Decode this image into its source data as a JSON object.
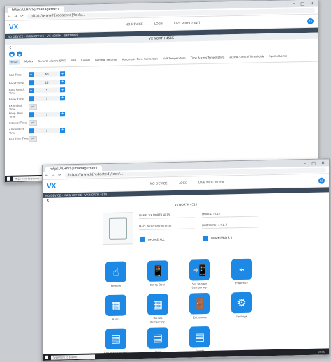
{
  "browser": {
    "tab": "https://(HIVS)/management",
    "url": "https://www.h[redacted]/lock/..."
  },
  "nav": {
    "logo": "VX",
    "items": [
      "NO DEVICE",
      "LOGS",
      "LIVE VIDEO/UNIT"
    ],
    "avatar": "KS"
  },
  "back": {
    "breadcrumb": "NO DEVICE - MAIN OFFICE - VX NORTH - SETTINGS",
    "title": "VX NORTH 4515",
    "tabs": [
      "Timer",
      "Modes",
      "General Alarms(EMS)",
      "APN",
      "Events",
      "General Settings",
      "Automatic Time Correction",
      "Half Temperature",
      "Time Access Temperature",
      "Access Control Thresholds",
      "Special Lanes"
    ],
    "rows": [
      {
        "label": "Call Time",
        "type": "stepper",
        "value": "60"
      },
      {
        "label": "Reset Time",
        "type": "stepper",
        "value": "15"
      },
      {
        "label": "Auto Relock Time",
        "type": "stepper",
        "value": "5"
      },
      {
        "label": "Relay Time",
        "type": "stepper",
        "value": "5"
      },
      {
        "label": "Extended Time",
        "type": "toggle",
        "value": "Off"
      },
      {
        "label": "Keep Alive Time",
        "type": "stepper",
        "value": "5"
      },
      {
        "label": "Interval Time",
        "type": "toggle",
        "value": "Off"
      },
      {
        "label": "Alarm Buzz Time",
        "type": "stepper",
        "value": "5"
      },
      {
        "label": "Led Blink Time",
        "type": "toggle",
        "value": "Off"
      }
    ]
  },
  "front": {
    "breadcrumb": "NO DEVICE - MAIN OFFICE - VX NORTH 4515",
    "device_title": "VX NORTH 4515",
    "name": "NAME: VX NORTH 4515",
    "model": "MODEL: 4515",
    "mac": "MAC: 00:00:00:00:00:00",
    "firmware": "FIRMWARE: 4.0.1.0",
    "upload": "UPLOAD ALL",
    "download": "DOWNLOAD ALL",
    "tiles": [
      {
        "label": "Remote",
        "icon": "☝"
      },
      {
        "label": "Set to Open",
        "icon": "📱"
      },
      {
        "label": "Set to open (temporary)",
        "icon": "📲"
      },
      {
        "label": "Proximity",
        "icon": "⌁"
      },
      {
        "label": "Users",
        "icon": "▦"
      },
      {
        "label": "Routes (temporary)",
        "icon": "▦"
      },
      {
        "label": "Entrances",
        "icon": "🚪"
      },
      {
        "label": "Settings",
        "icon": "⚙"
      },
      {
        "label": "Edit Management",
        "icon": "▤"
      },
      {
        "label": "Logs",
        "icon": "▤"
      },
      {
        "label": "Events",
        "icon": "▤"
      }
    ]
  },
  "taskbar": {
    "search": "Type here to search",
    "time": "10:01"
  }
}
